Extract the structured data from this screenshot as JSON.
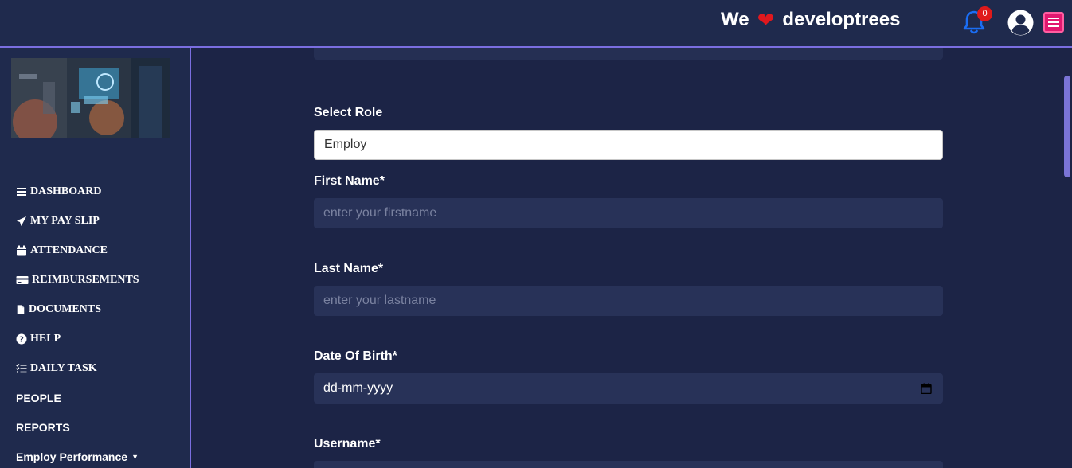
{
  "header": {
    "brand_prefix": "We",
    "brand_name": "developtrees",
    "notification_count": "0"
  },
  "icons": {
    "heart": "heart-icon",
    "bell": "bell-icon",
    "user": "user-circle-icon",
    "menu": "hamburger-menu-icon",
    "calendar": "calendar-icon"
  },
  "colors": {
    "accent": "#7a6ee0",
    "badge": "#e01a1a",
    "bell": "#1b6ef5",
    "menu_button": "#e2176f",
    "heart": "#e0181e"
  },
  "sidebar": {
    "items": [
      {
        "label": "DASHBOARD",
        "icon": "bars-icon"
      },
      {
        "label": "MY PAY SLIP",
        "icon": "paper-plane-icon"
      },
      {
        "label": "ATTENDANCE",
        "icon": "calendar-icon"
      },
      {
        "label": "REIMBURSEMENTS",
        "icon": "credit-card-icon"
      },
      {
        "label": "DOCUMENTS",
        "icon": "file-icon"
      },
      {
        "label": "HELP",
        "icon": "question-circle-icon"
      },
      {
        "label": "DAILY TASK",
        "icon": "task-list-icon"
      },
      {
        "label": "PEOPLE"
      },
      {
        "label": "REPORTS"
      },
      {
        "label": "Employ Performance"
      }
    ]
  },
  "form": {
    "role_label": "Select Role",
    "role_value": "Employ",
    "first_name_label": "First Name*",
    "first_name_placeholder": "enter your firstname",
    "last_name_label": "Last Name*",
    "last_name_placeholder": "enter your lastname",
    "dob_label": "Date Of Birth*",
    "dob_value": "dd-mm-yyyy",
    "username_label": "Username*"
  }
}
